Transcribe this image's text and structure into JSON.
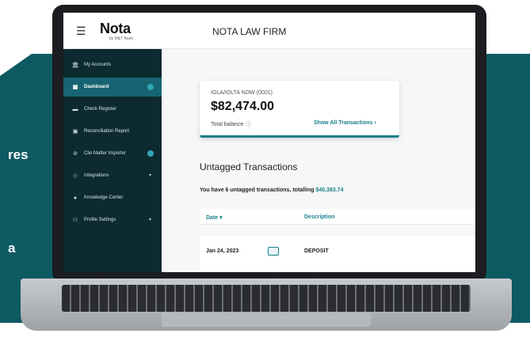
{
  "background_text": [
    "res",
    "a"
  ],
  "header": {
    "menu_icon": "hamburger-icon",
    "logo": "Nota",
    "logo_sub": "by M&T Bank",
    "firm_name": "NOTA LAW FIRM"
  },
  "sidebar": {
    "items": [
      {
        "label": "My Accounts",
        "icon": "bank-icon"
      },
      {
        "label": "Dashboard",
        "icon": "dashboard-icon",
        "active": true
      },
      {
        "label": "Check Register",
        "icon": "register-icon"
      },
      {
        "label": "Reconciliation Report",
        "icon": "report-icon"
      },
      {
        "label": "Clio Matter Importer",
        "icon": "import-icon"
      },
      {
        "label": "Integrations",
        "icon": "integrations-icon"
      },
      {
        "label": "Knowledge Center",
        "icon": "bulb-icon"
      },
      {
        "label": "Profile Settings",
        "icon": "users-icon"
      }
    ]
  },
  "balance_card": {
    "account_name": "IOLA/IOLTA NOW (0001)",
    "balance": "$82,474.00",
    "total_label": "Total balance",
    "show_all": "Show All Transactions"
  },
  "untagged": {
    "title": "Untagged Transactions",
    "summary_prefix": "You have 6 untagged transactions, totalling",
    "summary_amount": "$40,383.74",
    "columns": {
      "date": "Date",
      "description": "Description"
    },
    "rows": [
      {
        "date": "Jan 24, 2023",
        "description": "DEPOSIT"
      }
    ]
  },
  "colors": {
    "teal_bg": "#0e5a63",
    "sidebar": "#0c2a30",
    "active": "#176572",
    "accent": "#1a7f8b"
  }
}
